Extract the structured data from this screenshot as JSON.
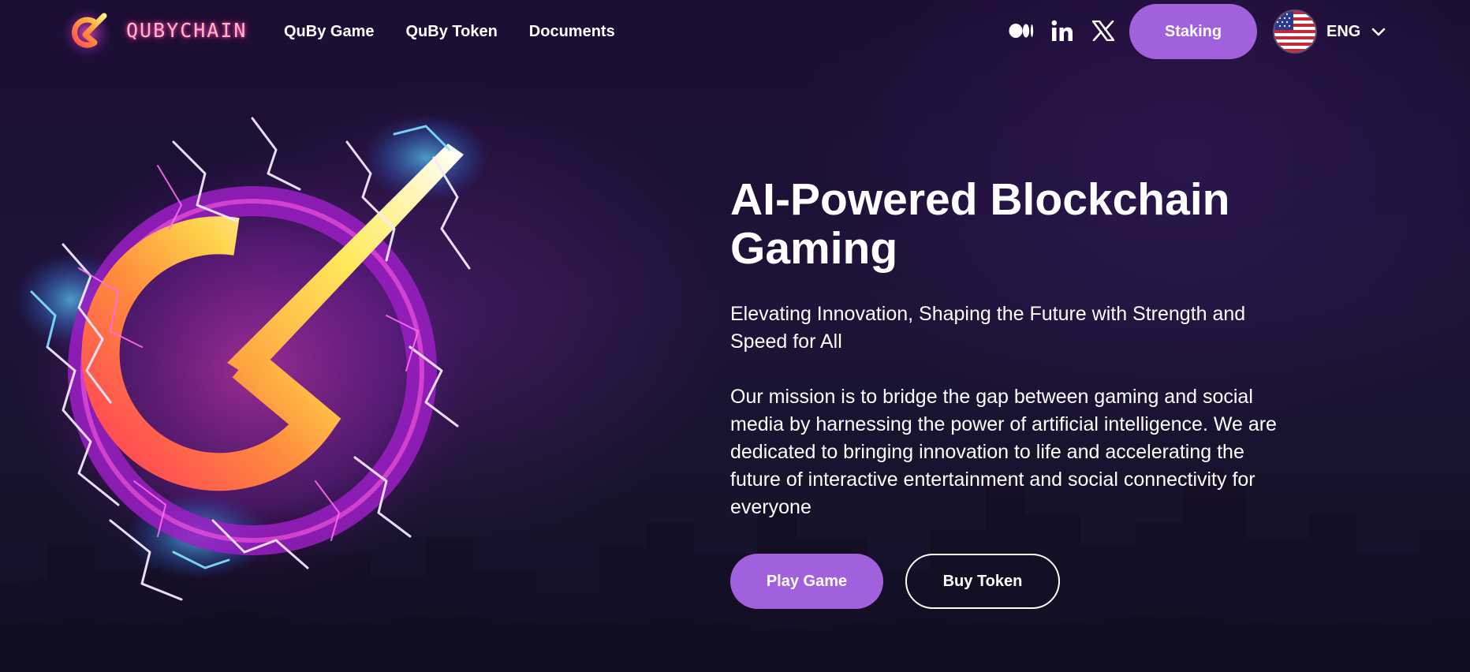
{
  "brand": {
    "name": "QUBYCHAIN"
  },
  "nav": {
    "items": [
      {
        "label": "QuBy Game"
      },
      {
        "label": "QuBy Token"
      },
      {
        "label": "Documents"
      }
    ]
  },
  "socials": [
    {
      "name": "medium-icon"
    },
    {
      "name": "linkedin-icon"
    },
    {
      "name": "x-twitter-icon"
    }
  ],
  "staking": {
    "label": "Staking"
  },
  "language": {
    "label": "ENG",
    "flag_icon": "us-flag-icon"
  },
  "hero": {
    "title": "AI-Powered Blockchain Gaming",
    "subtitle": "Elevating Innovation, Shaping the Future with Strength and Speed for All",
    "mission": "Our mission is to bridge the gap between gaming and social media by harnessing the power of artificial intelligence. We are dedicated to bringing innovation to life and accelerating the future of interactive entertainment and social connectivity for everyone",
    "play_label": "Play Game",
    "buy_label": "Buy Token"
  },
  "colors": {
    "background": "#1a0f2e",
    "accent": "#a261dc",
    "text": "#ffffff"
  }
}
